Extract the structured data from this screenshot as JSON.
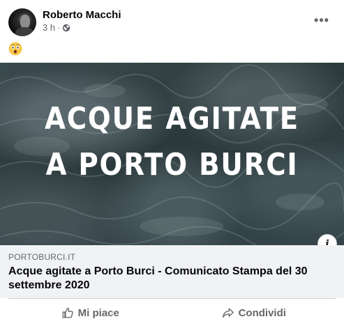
{
  "post": {
    "author": "Roberto Macchi",
    "time": "3 h",
    "separator": "·",
    "privacy_icon": "globe-icon",
    "more_icon": "more-horizontal-icon",
    "more_label": "•••",
    "emoji": "astonished-face-emoji"
  },
  "image": {
    "line1": "Acque agitate",
    "line2": "a Porto Burci",
    "info_label": "i"
  },
  "link": {
    "domain": "PORTOBURCI.IT",
    "title": "Acque agitate a Porto Burci - Comunicato Stampa del 30 settembre 2020"
  },
  "actions": {
    "like_label": "Mi piace",
    "like_icon": "thumbs-up-icon",
    "share_label": "Condividi",
    "share_icon": "share-arrow-icon"
  },
  "colors": {
    "secondary_text": "#65676b",
    "link_box_bg": "#f0f2f5"
  }
}
